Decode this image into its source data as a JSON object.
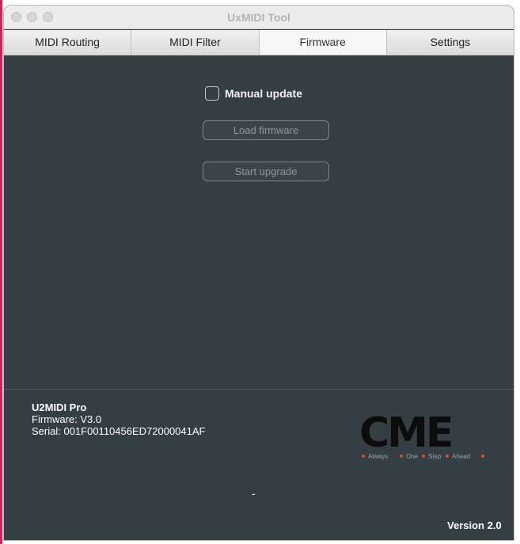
{
  "window": {
    "title": "UxMIDI Tool"
  },
  "tabs": [
    {
      "label": "MIDI Routing",
      "active": false
    },
    {
      "label": "MIDI Filter",
      "active": false
    },
    {
      "label": "Firmware",
      "active": true
    },
    {
      "label": "Settings",
      "active": false
    }
  ],
  "firmware": {
    "manual_update_label": "Manual update",
    "manual_update_checked": false,
    "load_button": "Load firmware",
    "start_button": "Start upgrade"
  },
  "device": {
    "name": "U2MIDI Pro",
    "firmware": "Firmware: V3.0",
    "serial": "Serial: 001F00110456ED72000041AF"
  },
  "logo": {
    "brand": "CME",
    "tagline": [
      "Always",
      "One",
      "Step",
      "Ahead"
    ],
    "accent_color": "#e04b1f"
  },
  "status": {
    "indicator": "-"
  },
  "version": "Version 2.0"
}
